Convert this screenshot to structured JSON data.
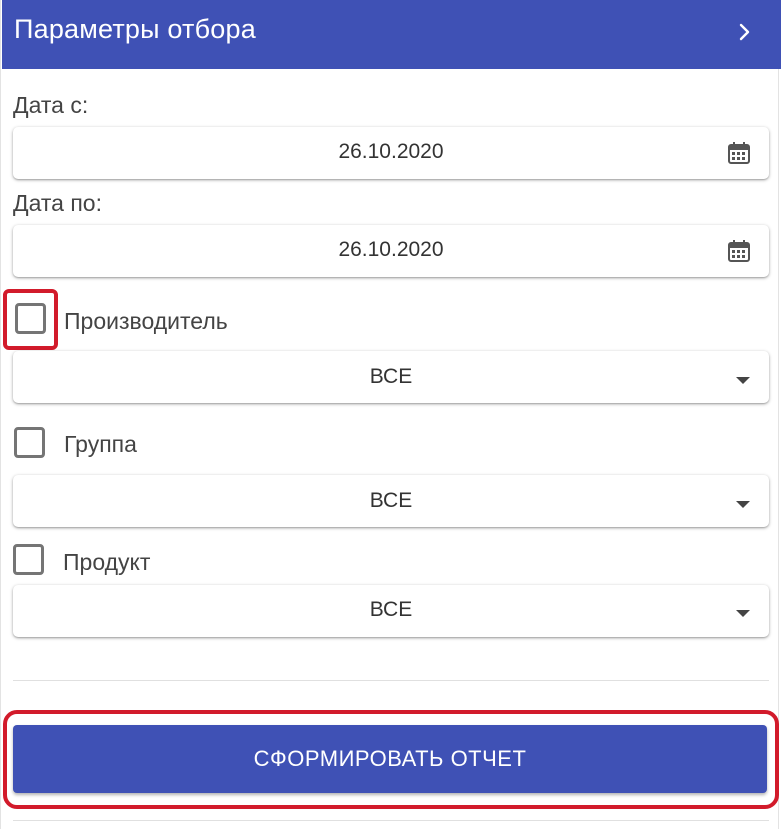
{
  "header": {
    "title": "Параметры отбора",
    "chevron_icon": "chevron-right-icon"
  },
  "date_from": {
    "label": "Дата с:",
    "value": "26.10.2020",
    "icon": "calendar-icon"
  },
  "date_to": {
    "label": "Дата по:",
    "value": "26.10.2020",
    "icon": "calendar-icon"
  },
  "manufacturer": {
    "label": "Производитель",
    "checked": false,
    "select_value": "ВСЕ"
  },
  "group": {
    "label": "Группа",
    "checked": false,
    "select_value": "ВСЕ"
  },
  "product": {
    "label": "Продукт",
    "checked": false,
    "select_value": "ВСЕ"
  },
  "submit": {
    "label": "СФОРМИРОВАТЬ ОТЧЕТ"
  },
  "colors": {
    "primary": "#3f51b5",
    "highlight": "#d21b2b"
  }
}
